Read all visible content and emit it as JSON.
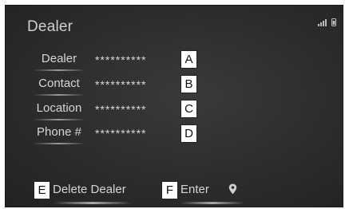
{
  "screen": {
    "title": "Dealer"
  },
  "rows": [
    {
      "label": "Dealer",
      "value": "**********",
      "callout": "A"
    },
    {
      "label": "Contact",
      "value": "**********",
      "callout": "B"
    },
    {
      "label": "Location",
      "value": "**********",
      "callout": "C"
    },
    {
      "label": "Phone #",
      "value": "**********",
      "callout": "D"
    }
  ],
  "buttons": {
    "delete": {
      "label": "Delete Dealer",
      "callout": "E"
    },
    "enter": {
      "label": "Enter",
      "callout": "F",
      "icon": "map-pin-icon"
    }
  },
  "status_icons": [
    "signal-icon",
    "phone-icon"
  ]
}
